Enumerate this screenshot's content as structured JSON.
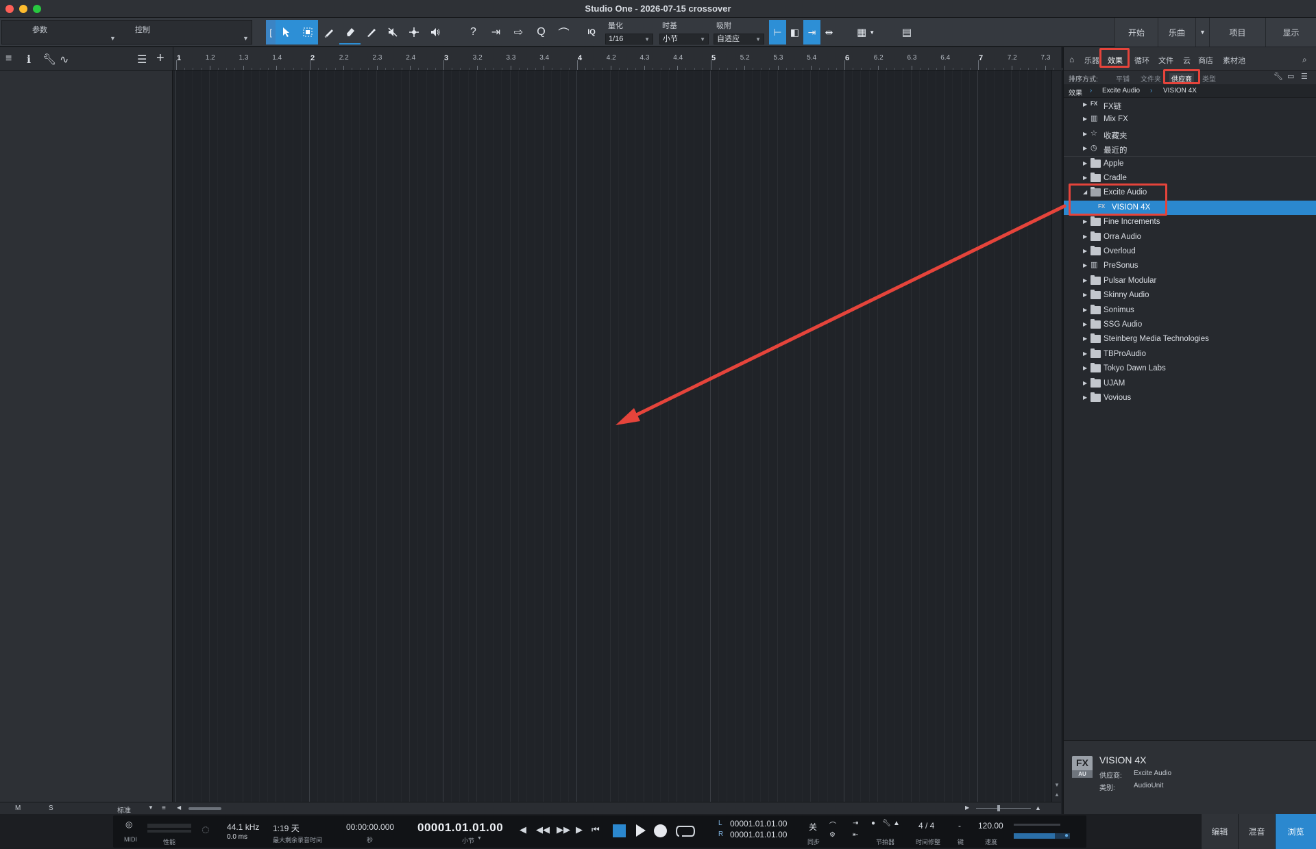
{
  "window": {
    "title": "Studio One - 2026-07-15 crossover"
  },
  "toolbar": {
    "params_label": "参数",
    "control_label": "控制",
    "quantize": {
      "label": "量化",
      "value": "1/16"
    },
    "timebase": {
      "label": "时基",
      "value": "小节"
    },
    "snap": {
      "label": "吸附",
      "value": "自适应"
    },
    "iq_label": "IQ",
    "right_tabs": [
      "开始",
      "乐曲",
      "项目",
      "显示"
    ]
  },
  "ruler": {
    "labels": [
      "1",
      "1.2",
      "1.3",
      "1.4",
      "2",
      "2.2",
      "2.3",
      "2.4",
      "3",
      "3.2",
      "3.3",
      "3.4",
      "4",
      "4.2",
      "4.3",
      "4.4",
      "5",
      "5.2",
      "5.3",
      "5.4",
      "6",
      "6.2",
      "6.3",
      "6.4",
      "7",
      "7.2",
      "7.3"
    ]
  },
  "arrange_bottom": {
    "m_label": "M",
    "s_label": "S",
    "zoom_label": "标准"
  },
  "browser": {
    "tabs": [
      "乐器",
      "效果",
      "循环",
      "文件",
      "云",
      "商店",
      "素材池"
    ],
    "selected_tab": "效果",
    "sort_label": "排序方式:",
    "sort_options": [
      "平铺",
      "文件夹",
      "供应商",
      "类型"
    ],
    "selected_sort": "供应商",
    "breadcrumb": [
      "效果",
      "Excite Audio",
      "VISION 4X"
    ],
    "tree": [
      {
        "label": "FX链",
        "icon": "fx-chain-icon",
        "expanded": false
      },
      {
        "label": "Mix FX",
        "icon": "mix-fx-icon",
        "expanded": false
      },
      {
        "label": "收藏夹",
        "icon": "star-icon",
        "expanded": false
      },
      {
        "label": "最近的",
        "icon": "clock-icon",
        "expanded": false
      },
      {
        "label": "Apple",
        "icon": "folder-icon",
        "expanded": false
      },
      {
        "label": "Cradle",
        "icon": "folder-icon",
        "expanded": false
      },
      {
        "label": "Excite Audio",
        "icon": "folder-open-icon",
        "expanded": true
      },
      {
        "label": "VISION 4X",
        "icon": "fx-plugin-icon",
        "child": true,
        "selected": true
      },
      {
        "label": "Fine Increments",
        "icon": "folder-icon",
        "expanded": false
      },
      {
        "label": "Orra Audio",
        "icon": "folder-icon",
        "expanded": false
      },
      {
        "label": "Overloud",
        "icon": "folder-icon",
        "expanded": false
      },
      {
        "label": "PreSonus",
        "icon": "presonus-icon",
        "expanded": false
      },
      {
        "label": "Pulsar Modular",
        "icon": "folder-icon",
        "expanded": false
      },
      {
        "label": "Skinny Audio",
        "icon": "folder-icon",
        "expanded": false
      },
      {
        "label": "Sonimus",
        "icon": "folder-icon",
        "expanded": false
      },
      {
        "label": "SSG Audio",
        "icon": "folder-icon",
        "expanded": false
      },
      {
        "label": "Steinberg Media Technologies",
        "icon": "folder-icon",
        "expanded": false
      },
      {
        "label": "TBProAudio",
        "icon": "folder-icon",
        "expanded": false
      },
      {
        "label": "Tokyo Dawn Labs",
        "icon": "folder-icon",
        "expanded": false
      },
      {
        "label": "UJAM",
        "icon": "folder-icon",
        "expanded": false
      },
      {
        "label": "Vovious",
        "icon": "folder-icon",
        "expanded": false
      }
    ],
    "info": {
      "badge": "FX",
      "badge_sub": "AU",
      "name": "VISION 4X",
      "vendor_key": "供应商:",
      "vendor_value": "Excite Audio",
      "category_key": "类别:",
      "category_value": "AudioUnit"
    }
  },
  "transport": {
    "midi_label": "MIDI",
    "perf_label": "性能",
    "sample_rate": "44.1 kHz",
    "latency": "0.0 ms",
    "record_time": "1:19 天",
    "record_time_label": "最大剩余录音时间",
    "seconds_value": "00:00:00.000",
    "seconds_label": "秒",
    "position": "00001.01.01.00",
    "position_label": "小节",
    "loop_l_key": "L",
    "loop_l": "00001.01.01.00",
    "loop_r_key": "R",
    "loop_r": "00001.01.01.00",
    "sync_value": "关",
    "sync_label": "同步",
    "metronome_label": "节拍器",
    "time_sig": "4 / 4",
    "time_sig_label": "时间修整",
    "key_value": "-",
    "key_label": "键",
    "tempo": "120.00",
    "tempo_label": "速度",
    "view_tabs": [
      "编辑",
      "混音",
      "浏览"
    ],
    "selected_view": "浏览"
  },
  "colors": {
    "accent": "#2b88cf",
    "highlight": "#e5443b",
    "background": "#202328"
  }
}
